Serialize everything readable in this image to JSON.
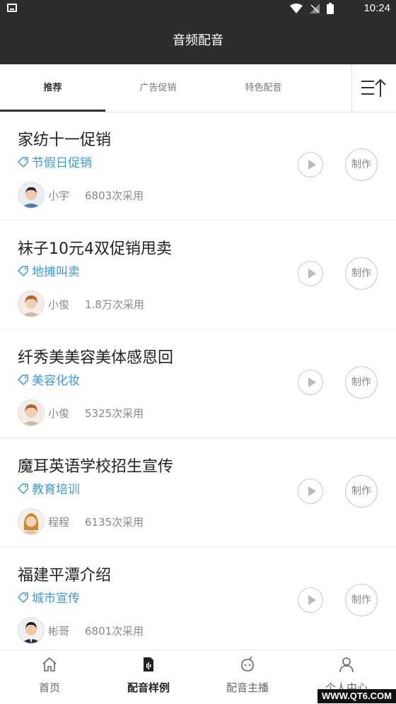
{
  "status_bar": {
    "time": "10:24"
  },
  "header": {
    "title": "音频配音"
  },
  "tabs": [
    {
      "label": "推荐",
      "active": true
    },
    {
      "label": "广告促销",
      "active": false
    },
    {
      "label": "特色配音",
      "active": false
    }
  ],
  "menu_icon": "sort-menu-icon",
  "items": [
    {
      "title": "家纺十一促销",
      "tag": "节假日促销",
      "author": "小宇",
      "uses": "6803次采用",
      "make_label": "制作"
    },
    {
      "title": "袜子10元4双促销甩卖",
      "tag": "地摊叫卖",
      "author": "小俊",
      "uses": "1.8万次采用",
      "make_label": "制作"
    },
    {
      "title": "纤秀美美容美体感恩回",
      "tag": "美容化妆",
      "author": "小俊",
      "uses": "5325次采用",
      "make_label": "制作"
    },
    {
      "title": "魔耳英语学校招生宣传",
      "tag": "教育培训",
      "author": "程程",
      "uses": "6135次采用",
      "make_label": "制作"
    },
    {
      "title": "福建平潭介绍",
      "tag": "城市宣传",
      "author": "彬哥",
      "uses": "6801次采用",
      "make_label": "制作"
    }
  ],
  "bottom_nav": [
    {
      "label": "首页",
      "icon": "home-icon",
      "active": false
    },
    {
      "label": "配音样例",
      "icon": "audio-file-icon",
      "active": true
    },
    {
      "label": "配音主播",
      "icon": "robot-icon",
      "active": false
    },
    {
      "label": "个人中心",
      "icon": "user-icon",
      "active": false
    }
  ],
  "watermark": "WWW.QT6.COM",
  "colors": {
    "header_bg": "#2d2d2d",
    "tag_blue": "#3a9bdc"
  }
}
